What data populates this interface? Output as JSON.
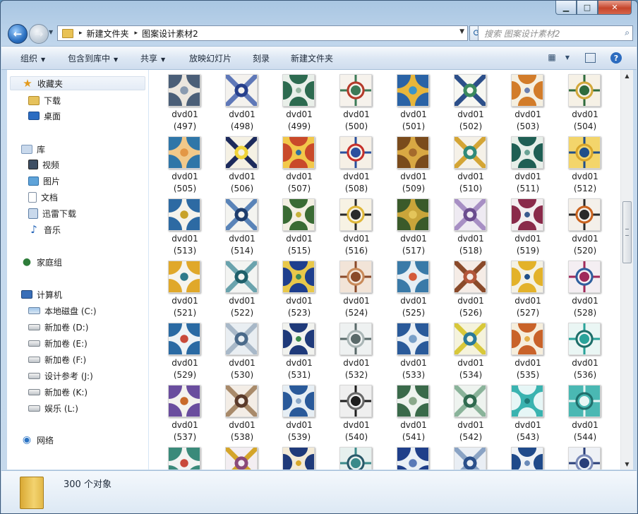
{
  "window": {
    "minimize": "▁",
    "maximize": "□",
    "close": "✕"
  },
  "nav": {
    "back_icon": "←",
    "forward_icon": "→",
    "recent_icon": "▼"
  },
  "address": {
    "crumbs": [
      "新建文件夹",
      "图案设计素材2"
    ],
    "sep": "▸",
    "dropdown": "▼",
    "refresh": "⟳"
  },
  "search": {
    "placeholder": "搜索 图案设计素材2",
    "icon": "⌕"
  },
  "toolbar": {
    "organize": "组织",
    "include": "包含到库中",
    "share": "共享",
    "slideshow": "放映幻灯片",
    "burn": "刻录",
    "new_folder": "新建文件夹",
    "arrow": "▼",
    "help": "?"
  },
  "sidebar": {
    "favorites": "收藏夹",
    "downloads": "下载",
    "desktop": "桌面",
    "libraries": "库",
    "videos": "视频",
    "pictures": "图片",
    "documents": "文档",
    "xunlei": "迅雷下载",
    "music": "音乐",
    "homegroup": "家庭组",
    "computer": "计算机",
    "drive_c": "本地磁盘 (C:)",
    "drive_d": "新加卷 (D:)",
    "drive_e": "新加卷 (E:)",
    "drive_f": "新加卷 (F:)",
    "drive_j": "设计参考 (J:)",
    "drive_k": "新加卷 (K:)",
    "drive_l": "娱乐 (L:)",
    "network": "网络"
  },
  "files": {
    "name": "dvd01",
    "items": [
      {
        "n": "(497)",
        "c": [
          "#ece7df",
          "#4b5f78",
          "#8a9bb0"
        ]
      },
      {
        "n": "(498)",
        "c": [
          "#f4f2ee",
          "#263f8c",
          "#5f78b8"
        ]
      },
      {
        "n": "(499)",
        "c": [
          "#e9efe9",
          "#2d6b50",
          "#98b8a3"
        ]
      },
      {
        "n": "(500)",
        "c": [
          "#f6f2ec",
          "#3c7a57",
          "#b53b2b"
        ]
      },
      {
        "n": "(501)",
        "c": [
          "#e8b63b",
          "#2a63a6",
          "#3b94c9"
        ]
      },
      {
        "n": "(502)",
        "c": [
          "#f7f7f2",
          "#3c8a5f",
          "#2c4f8a"
        ]
      },
      {
        "n": "(503)",
        "c": [
          "#f5efe0",
          "#d27c2a",
          "#6a7fb0"
        ]
      },
      {
        "n": "(504)",
        "c": [
          "#f6f1e6",
          "#2f6b3c",
          "#d2a83a"
        ]
      },
      {
        "n": "(505)",
        "c": [
          "#f1c98a",
          "#2f76a8",
          "#e39745"
        ]
      },
      {
        "n": "(506)",
        "c": [
          "#f5f1e4",
          "#f0d43a",
          "#1c2a5c"
        ]
      },
      {
        "n": "(507)",
        "c": [
          "#f2c84a",
          "#c94a2a",
          "#2f6f9e"
        ]
      },
      {
        "n": "(508)",
        "c": [
          "#f6f0e6",
          "#2a4f9e",
          "#c7312b"
        ]
      },
      {
        "n": "(509)",
        "c": [
          "#d9a843",
          "#7a4b1c",
          "#a56a2c"
        ]
      },
      {
        "n": "(510)",
        "c": [
          "#f5f1e8",
          "#2f8a7a",
          "#d4a535"
        ]
      },
      {
        "n": "(511)",
        "c": [
          "#e7efe9",
          "#1f5f54",
          "#6aa394"
        ]
      },
      {
        "n": "(512)",
        "c": [
          "#f3d56b",
          "#1f4f8a",
          "#d8a52a"
        ]
      },
      {
        "n": "(513)",
        "c": [
          "#f5f3ec",
          "#2d6aa3",
          "#c8a22a"
        ]
      },
      {
        "n": "(514)",
        "c": [
          "#f4f4f0",
          "#1e3d6c",
          "#5a84b8"
        ]
      },
      {
        "n": "(515)",
        "c": [
          "#f3efe2",
          "#3a6b34",
          "#c7b23a"
        ]
      },
      {
        "n": "(516)",
        "c": [
          "#f7f2e4",
          "#2a2a2a",
          "#e0b83a"
        ]
      },
      {
        "n": "(517)",
        "c": [
          "#c9a53a",
          "#3a5a2a",
          "#e4c55a"
        ]
      },
      {
        "n": "(518)",
        "c": [
          "#eeeaf2",
          "#6a4d8e",
          "#a78fc4"
        ]
      },
      {
        "n": "(519)",
        "c": [
          "#f3eef0",
          "#8a2a4a",
          "#3a5a8e"
        ]
      },
      {
        "n": "(520)",
        "c": [
          "#f4f0ea",
          "#2a2a2a",
          "#c9631f"
        ]
      },
      {
        "n": "(521)",
        "c": [
          "#f6f4ee",
          "#e0a82a",
          "#2f7a8a"
        ]
      },
      {
        "n": "(522)",
        "c": [
          "#f3f4f2",
          "#1f5f6a",
          "#6aa3ad"
        ]
      },
      {
        "n": "(523)",
        "c": [
          "#e8c84a",
          "#1e3f8e",
          "#3a8a5a"
        ]
      },
      {
        "n": "(524)",
        "c": [
          "#f2e4d8",
          "#8a4a2a",
          "#c98a5a"
        ]
      },
      {
        "n": "(525)",
        "c": [
          "#e6eef4",
          "#3a7aa8",
          "#d45a3a"
        ]
      },
      {
        "n": "(526)",
        "c": [
          "#f5ece6",
          "#b3563a",
          "#8a4a2a"
        ]
      },
      {
        "n": "(527)",
        "c": [
          "#f4f1e4",
          "#e3b22a",
          "#1f4f8a"
        ]
      },
      {
        "n": "(528)",
        "c": [
          "#f4eef2",
          "#a02a5a",
          "#2f5f9e"
        ]
      },
      {
        "n": "(529)",
        "c": [
          "#eef3f6",
          "#2a6aa3",
          "#c94a3a"
        ]
      },
      {
        "n": "(530)",
        "c": [
          "#e9eef2",
          "#4a6a8a",
          "#a8b8c8"
        ]
      },
      {
        "n": "(531)",
        "c": [
          "#f1f2ee",
          "#1f3a7a",
          "#3a8a4a"
        ]
      },
      {
        "n": "(532)",
        "c": [
          "#eef1f1",
          "#5a6a6a",
          "#aab6b6"
        ]
      },
      {
        "n": "(533)",
        "c": [
          "#eaf0f6",
          "#2a5a9a",
          "#7aa0c8"
        ]
      },
      {
        "n": "(534)",
        "c": [
          "#f5f3dc",
          "#2a7a9a",
          "#d8c83a"
        ]
      },
      {
        "n": "(535)",
        "c": [
          "#f6eedc",
          "#c9632a",
          "#e4b04a"
        ]
      },
      {
        "n": "(536)",
        "c": [
          "#eaf6f4",
          "#2aa39a",
          "#1f6f6a"
        ]
      },
      {
        "n": "(537)",
        "c": [
          "#f4f2ee",
          "#6a4d9e",
          "#c96a2a"
        ]
      },
      {
        "n": "(538)",
        "c": [
          "#f3ede6",
          "#5a3a2a",
          "#a88a6a"
        ]
      },
      {
        "n": "(539)",
        "c": [
          "#e6eef4",
          "#2a5a9a",
          "#8aa8c8"
        ]
      },
      {
        "n": "(540)",
        "c": [
          "#efefef",
          "#1e1e1e",
          "#6a6a6a"
        ]
      },
      {
        "n": "(541)",
        "c": [
          "#eef3ee",
          "#3a6a4a",
          "#8aa88a"
        ]
      },
      {
        "n": "(542)",
        "c": [
          "#eef3ef",
          "#2f6a4f",
          "#8ab39a"
        ]
      },
      {
        "n": "(543)",
        "c": [
          "#3ab3b0",
          "#e6f6f6",
          "#1f7a78"
        ]
      },
      {
        "n": "(544)",
        "c": [
          "#4ab8b3",
          "#e8f6f5",
          "#1f6f6c"
        ]
      },
      {
        "n": "",
        "c": [
          "#f2f4f2",
          "#3a8a7a",
          "#c94a3a"
        ]
      },
      {
        "n": "",
        "c": [
          "#f3eef2",
          "#8a4a7a",
          "#d4a52a"
        ]
      },
      {
        "n": "",
        "c": [
          "#f3ead6",
          "#1f3a7a",
          "#d8a82a"
        ]
      },
      {
        "n": "",
        "c": [
          "#e6f0ee",
          "#3a8a8a",
          "#2a5a6a"
        ]
      },
      {
        "n": "",
        "c": [
          "#eaf0f6",
          "#1f3f8a",
          "#5a7ab8"
        ]
      },
      {
        "n": "",
        "c": [
          "#e9eef4",
          "#2a4f8a",
          "#8aa3c4"
        ]
      },
      {
        "n": "",
        "c": [
          "#eef2f6",
          "#1f4a8a",
          "#6a8ab8"
        ]
      },
      {
        "n": "",
        "c": [
          "#eef1f6",
          "#2a3f7a",
          "#7a8ab8"
        ]
      }
    ]
  },
  "status": {
    "count": "300 个对象"
  },
  "scrollbar": {
    "up": "▲",
    "down": "▼"
  }
}
